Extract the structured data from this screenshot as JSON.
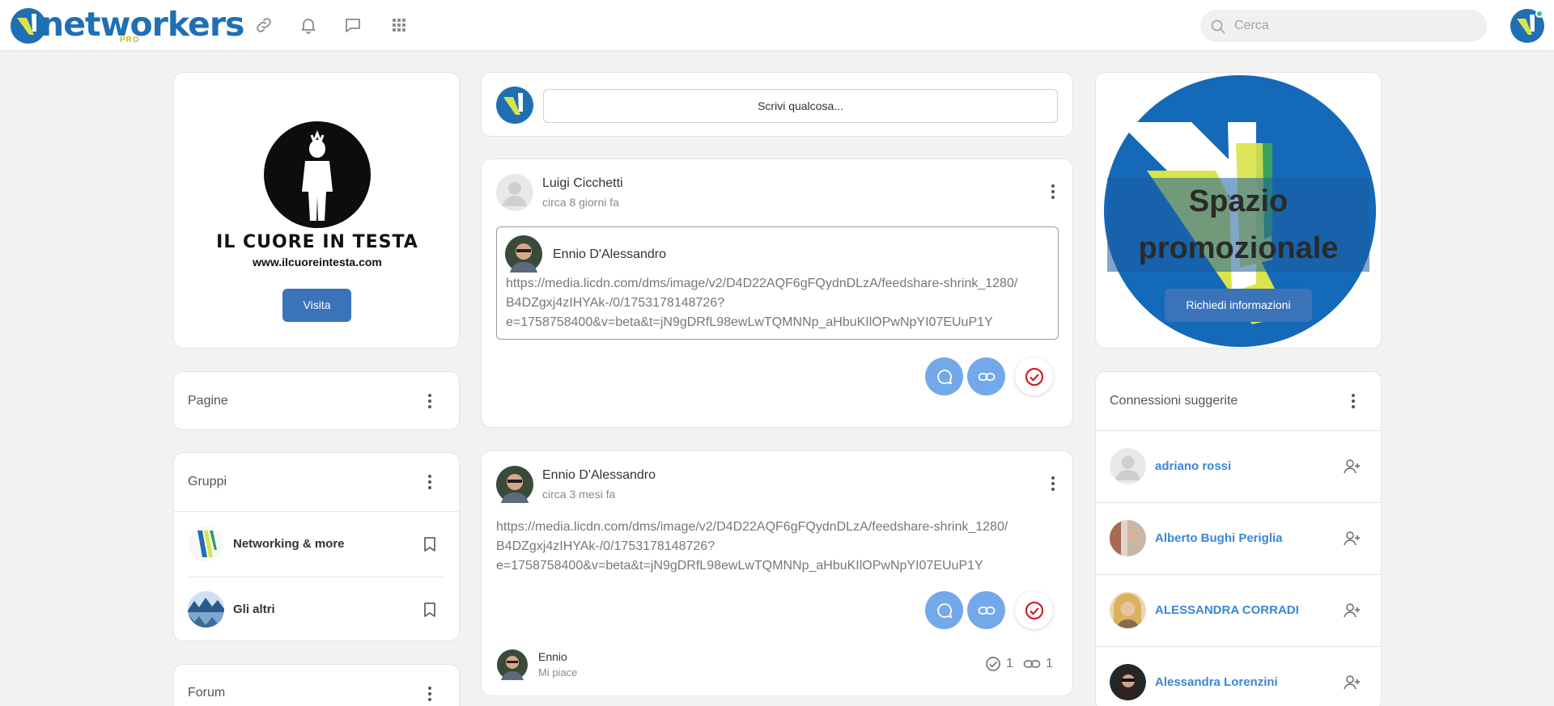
{
  "header": {
    "logo_text": "networkers",
    "logo_badge": "PRO",
    "search_placeholder": "Cerca"
  },
  "icons": [
    "link-icon",
    "bell-icon",
    "chat-icon",
    "apps-grid-icon",
    "search-icon",
    "more-vertical-icon",
    "bookmark-icon",
    "user-plus-icon",
    "check-circle-icon"
  ],
  "colors": {
    "brand_blue": "#1f6fb5",
    "button_blue": "#3b73b9",
    "fab_blue": "#74a9e9",
    "link_blue": "#3b86d6",
    "check_red": "#d0202a",
    "accent_lime": "#b5c21a"
  },
  "left": {
    "promo": {
      "brand_name": "IL CUORE IN TESTA",
      "brand_url": "www.ilcuoreintesta.com",
      "visit_label": "Visita"
    },
    "pages_title": "Pagine",
    "groups_title": "Gruppi",
    "groups": [
      {
        "name": "Networking & more"
      },
      {
        "name": "Gli altri"
      }
    ],
    "forum_title": "Forum"
  },
  "composer": {
    "placeholder": "Scrivi qualcosa..."
  },
  "posts": [
    {
      "author": "Luigi Cicchetti",
      "time": "circa 8 giorni fa",
      "shared": {
        "author": "Ennio D'Alessandro",
        "link_lines": [
          "https://media.licdn.com/dms/image/v2/D4D22AQF6gFQydnDLzA/feedshare-shrink_1280/",
          "B4DZgxj4zIHYAk-/0/1753178148726?",
          "e=1758758400&v=beta&t=jN9gDRfL98ewLwTQMNNp_aHbuKIlOPwNpYI07EUuP1Y"
        ]
      }
    },
    {
      "author": "Ennio D'Alessandro",
      "time": "circa 3 mesi fa",
      "link_lines": [
        "https://media.licdn.com/dms/image/v2/D4D22AQF6gFQydnDLzA/feedshare-shrink_1280/",
        "B4DZgxj4zIHYAk-/0/1753178148726?",
        "e=1758758400&v=beta&t=jN9gDRfL98ewLwTQMNNp_aHbuKIlOPwNpYI07EUuP1Y"
      ],
      "reaction": {
        "name": "Ennio",
        "label": "Mi piace"
      },
      "likes_count": "1",
      "links_count": "1"
    }
  ],
  "right": {
    "promo_title_line1": "Spazio",
    "promo_title_line2": "promozionale",
    "promo_button": "Richiedi informazioni",
    "connections_title": "Connessioni suggerite",
    "connections": [
      {
        "name": "adriano rossi"
      },
      {
        "name": "Alberto Bughi Periglia"
      },
      {
        "name": "ALESSANDRA CORRADI"
      },
      {
        "name": "Alessandra Lorenzini"
      }
    ]
  }
}
